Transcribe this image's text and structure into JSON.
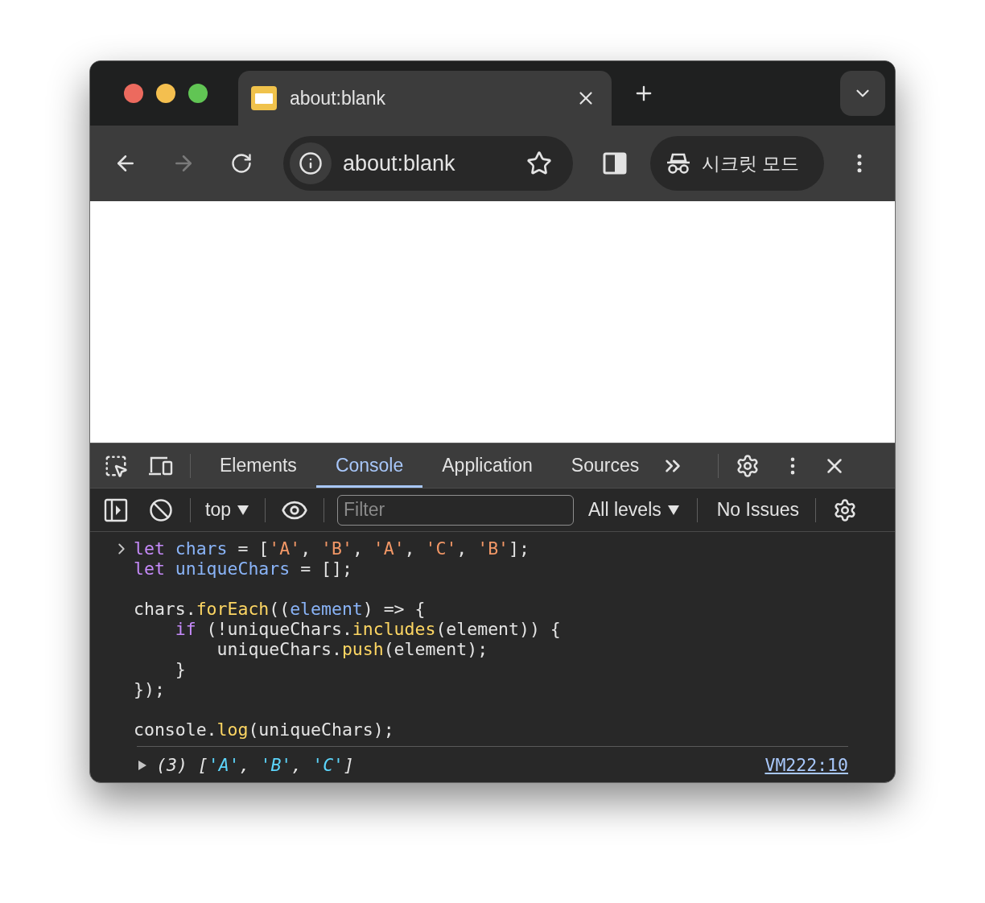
{
  "tabs": [
    {
      "title": "about:blank",
      "selected": true
    }
  ],
  "toolbar": {
    "forward_disabled": true,
    "address": "about:blank",
    "incognito_label": "시크릿 모드"
  },
  "devtools": {
    "panels": [
      {
        "label": "Elements",
        "selected": false
      },
      {
        "label": "Console",
        "selected": true
      },
      {
        "label": "Application",
        "selected": false
      },
      {
        "label": "Sources",
        "selected": false
      }
    ],
    "console_toolbar": {
      "context": "top",
      "filter_placeholder": "Filter",
      "levels": "All levels",
      "issues": "No Issues"
    },
    "input_blocks": [
      [
        [
          {
            "text": "let",
            "kind": "keyword"
          },
          {
            "text": " chars",
            "kind": "variable"
          },
          {
            "text": " = [",
            "kind": "plain"
          },
          {
            "text": "'A'",
            "kind": "string"
          },
          {
            "text": ", ",
            "kind": "plain"
          },
          {
            "text": "'B'",
            "kind": "string"
          },
          {
            "text": ", ",
            "kind": "plain"
          },
          {
            "text": "'A'",
            "kind": "string"
          },
          {
            "text": ", ",
            "kind": "plain"
          },
          {
            "text": "'C'",
            "kind": "string"
          },
          {
            "text": ", ",
            "kind": "plain"
          },
          {
            "text": "'B'",
            "kind": "string"
          },
          {
            "text": "];",
            "kind": "plain"
          }
        ],
        [
          {
            "text": "let",
            "kind": "keyword"
          },
          {
            "text": " uniqueChars",
            "kind": "variable"
          },
          {
            "text": " = [];",
            "kind": "plain"
          }
        ]
      ],
      [
        [
          {
            "text": "chars.",
            "kind": "plain"
          },
          {
            "text": "forEach",
            "kind": "function"
          },
          {
            "text": "((",
            "kind": "plain"
          },
          {
            "text": "element",
            "kind": "variable"
          },
          {
            "text": ") => {",
            "kind": "plain"
          }
        ],
        [
          {
            "text": "    if",
            "kind": "keyword"
          },
          {
            "text": " (!uniqueChars.",
            "kind": "plain"
          },
          {
            "text": "includes",
            "kind": "function"
          },
          {
            "text": "(element)) {",
            "kind": "plain"
          }
        ],
        [
          {
            "text": "        uniqueChars.",
            "kind": "plain"
          },
          {
            "text": "push",
            "kind": "function"
          },
          {
            "text": "(element);",
            "kind": "plain"
          }
        ],
        [
          {
            "text": "    }",
            "kind": "plain"
          }
        ],
        [
          {
            "text": "});",
            "kind": "plain"
          }
        ]
      ],
      [
        [
          {
            "text": "console.",
            "kind": "plain"
          },
          {
            "text": "log",
            "kind": "function"
          },
          {
            "text": "(uniqueChars);",
            "kind": "plain"
          }
        ]
      ]
    ],
    "output": {
      "expanded": false,
      "tokens": [
        {
          "text": "(3) [",
          "kind": "plain"
        },
        {
          "text": "'A'",
          "kind": "string"
        },
        {
          "text": ", ",
          "kind": "plain"
        },
        {
          "text": "'B'",
          "kind": "string"
        },
        {
          "text": ", ",
          "kind": "plain"
        },
        {
          "text": "'C'",
          "kind": "string"
        },
        {
          "text": "]",
          "kind": "plain"
        }
      ],
      "source": "VM222:10"
    }
  }
}
